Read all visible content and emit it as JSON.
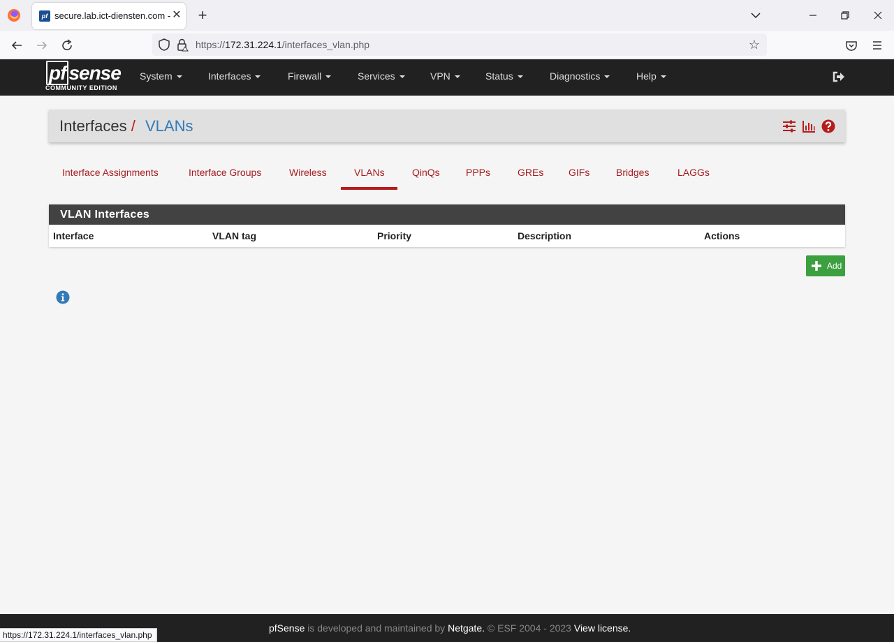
{
  "browser": {
    "tab_title": "secure.lab.ict-diensten.com - Interfaces: VLANs",
    "url_prefix": "https://",
    "url_host": "172.31.224.1",
    "url_path": "/interfaces_vlan.php",
    "status_url": "https://172.31.224.1/interfaces_vlan.php"
  },
  "logo": {
    "brand_pf": "pf",
    "brand_sense": "sense",
    "edition": "COMMUNITY EDITION"
  },
  "menu": [
    {
      "label": "System"
    },
    {
      "label": "Interfaces"
    },
    {
      "label": "Firewall"
    },
    {
      "label": "Services"
    },
    {
      "label": "VPN"
    },
    {
      "label": "Status"
    },
    {
      "label": "Diagnostics"
    },
    {
      "label": "Help"
    }
  ],
  "breadcrumb": {
    "parent": "Interfaces",
    "separator": "/",
    "current": "VLANs"
  },
  "subtabs": [
    {
      "label": "Interface Assignments"
    },
    {
      "label": "Interface Groups"
    },
    {
      "label": "Wireless"
    },
    {
      "label": "VLANs",
      "active": true
    },
    {
      "label": "QinQs"
    },
    {
      "label": "PPPs"
    },
    {
      "label": "GREs"
    },
    {
      "label": "GIFs"
    },
    {
      "label": "Bridges"
    },
    {
      "label": "LAGGs"
    }
  ],
  "panel": {
    "title": "VLAN Interfaces",
    "columns": [
      "Interface",
      "VLAN tag",
      "Priority",
      "Description",
      "Actions"
    ],
    "rows": []
  },
  "add_button": {
    "label": "Add"
  },
  "footer": {
    "brand": "pfSense",
    "text1": " is developed and maintained by ",
    "company": "Netgate.",
    "text2": " © ESF 2004 - 2023 ",
    "license": "View license."
  },
  "colors": {
    "accent_red": "#b71c1c",
    "link_blue": "#337ab7",
    "header_dark": "#212121",
    "add_green": "#3c9f40"
  }
}
